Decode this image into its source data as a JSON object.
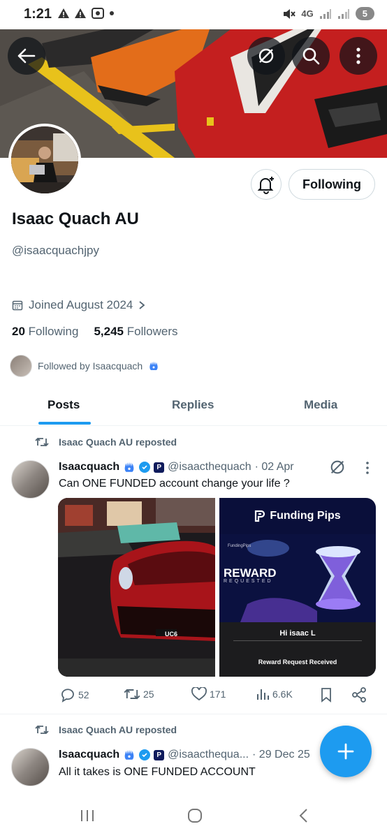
{
  "status_bar": {
    "time": "1:21",
    "network": "4G",
    "battery": "5"
  },
  "profile": {
    "name": "Isaac Quach AU",
    "handle": "@isaacquachjpy",
    "joined": "Joined August 2024",
    "following_count": "20",
    "following_label": "Following",
    "followers_count": "5,245",
    "followers_label": "Followers",
    "followed_by": "Followed by Isaacquach"
  },
  "buttons": {
    "following": "Following"
  },
  "tabs": [
    {
      "label": "Posts",
      "active": true
    },
    {
      "label": "Replies",
      "active": false
    },
    {
      "label": "Media",
      "active": false
    }
  ],
  "posts": [
    {
      "repost_label": "Isaac Quach AU reposted",
      "author": "Isaacquach",
      "handle": "@isaacthequach",
      "date": "· 02 Apr",
      "text": "Can ONE FUNDED account change your life ?",
      "media_right": {
        "brand": "Funding Pips",
        "small_brand": "FundingPips",
        "reward": "REWARD",
        "requested": "REQUESTED",
        "greeting": "Hi isaac L",
        "message": "Reward Request Received"
      },
      "media_left": {
        "plate": "UC6"
      },
      "replies": "52",
      "reposts": "25",
      "likes": "171",
      "views": "6.6K"
    },
    {
      "repost_label": "Isaac Quach AU reposted",
      "author": "Isaacquach",
      "handle": "@isaacthequa...",
      "date": "· 29 Dec 25",
      "text": "All it takes is ONE FUNDED ACCOUNT"
    }
  ],
  "colors": {
    "accent": "#1d9bf0",
    "text_primary": "#0f1419",
    "text_secondary": "#536471"
  }
}
